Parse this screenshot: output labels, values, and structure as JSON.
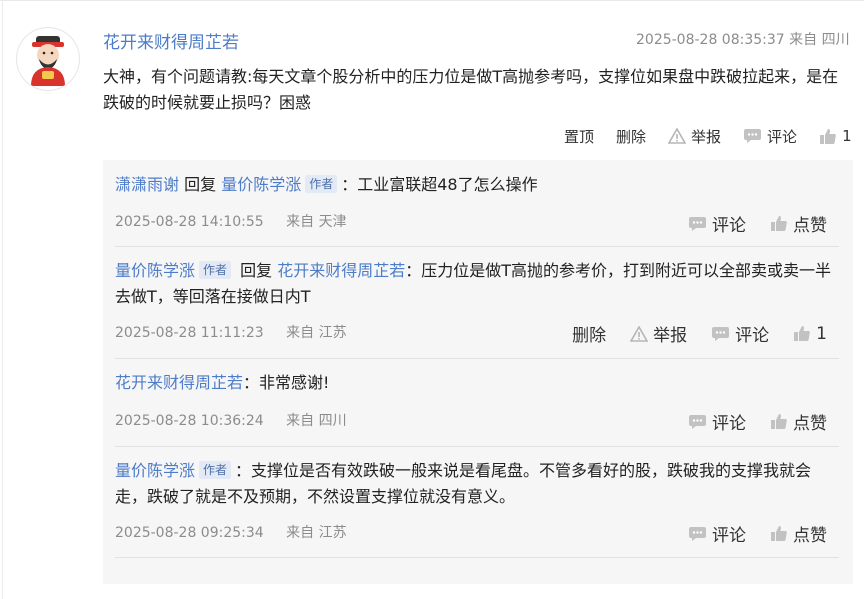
{
  "comment": {
    "username": "花开来财得周芷若",
    "meta": "2025-08-28 08:35:37 来自 四川",
    "content": "大神，有个问题请教:每天文章个股分析中的压力位是做T高抛参考吗，支撑位如果盘中跌破拉起来，是在跌破的时候就要止损吗？困惑",
    "actions": {
      "pin": "置顶",
      "delete": "删除",
      "report": "举报",
      "comment": "评论",
      "like_count": "1"
    }
  },
  "replies": [
    {
      "user": "潇潇雨谢",
      "reply_word": "回复",
      "target": "量价陈学涨",
      "target_tag": "作者",
      "text": "：工业富联超48了怎么操作",
      "time": "2025-08-28 14:10:55",
      "location": "来自 天津",
      "comment_label": "评论",
      "like_label": "点赞"
    },
    {
      "user": "量价陈学涨",
      "user_tag": "作者",
      "reply_word": "回复",
      "target": "花开来财得周芷若",
      "text": "：压力位是做T高抛的参考价，打到附近可以全部卖或卖一半去做T，等回落在接做日内T",
      "time": "2025-08-28 11:11:23",
      "location": "来自 江苏",
      "delete_label": "删除",
      "report_label": "举报",
      "comment_label": "评论",
      "like_count": "1"
    },
    {
      "user": "花开来财得周芷若",
      "text": "：非常感谢!",
      "time": "2025-08-28 10:36:24",
      "location": "来自 四川",
      "comment_label": "评论",
      "like_label": "点赞"
    },
    {
      "user": "量价陈学涨",
      "user_tag": "作者",
      "text": "：支撑位是否有效跌破一般来说是看尾盘。不管多看好的股，跌破我的支撑我就会走，跌破了就是不及预期，不然设置支撑位就没有意义。",
      "time": "2025-08-28 09:25:34",
      "location": "来自 江苏",
      "comment_label": "评论",
      "like_label": "点赞"
    }
  ],
  "colors": {
    "link": "#4d7cc8",
    "meta": "#8c8c8c",
    "reply_bg": "#f6f6f6",
    "tag_bg": "#e3eaf6"
  },
  "icons": [
    "avatar-caishen",
    "report-warning-icon",
    "comment-bubble-icon",
    "thumbs-up-icon"
  ]
}
